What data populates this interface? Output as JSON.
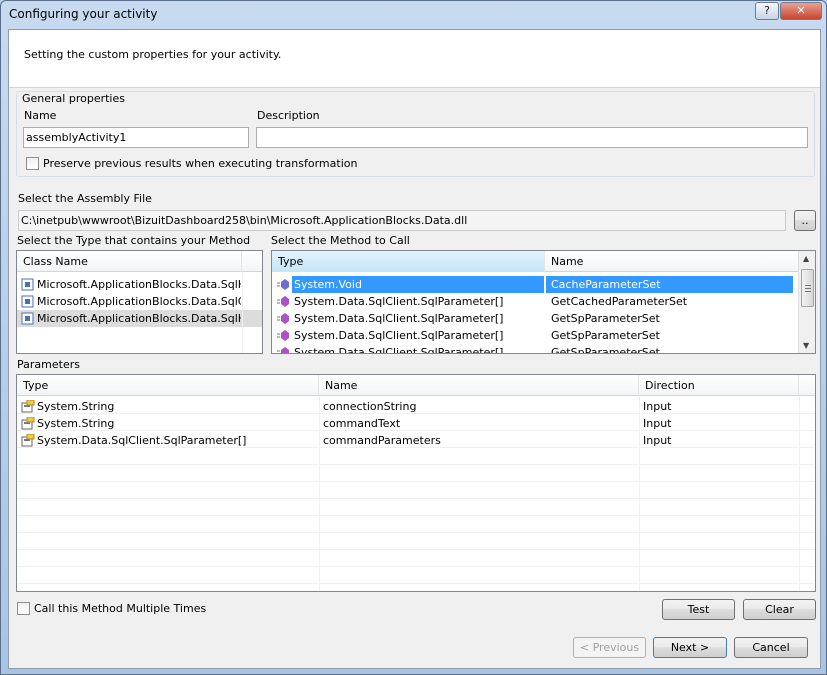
{
  "window": {
    "title": "Configuring your activity",
    "help_label": "?",
    "close_label": "✕"
  },
  "header": {
    "description": "Setting the custom properties for your activity."
  },
  "general": {
    "group_label": "General properties",
    "name_label": "Name",
    "name_value": "assemblyActivity1",
    "description_label": "Description",
    "description_value": "",
    "preserve_label": "Preserve previous results when executing transformation",
    "preserve_checked": false
  },
  "assembly": {
    "label": "Select the Assembly File",
    "path": "C:\\inetpub\\wwwroot\\BizuitDashboard258\\bin\\Microsoft.ApplicationBlocks.Data.dll",
    "browse_label": ".."
  },
  "types": {
    "label": "Select the Type that contains your Method",
    "column": "Class Name",
    "rows": [
      {
        "name": "Microsoft.ApplicationBlocks.Data.SqlHe...",
        "selected": false
      },
      {
        "name": "Microsoft.ApplicationBlocks.Data.SqlCo...",
        "selected": false
      },
      {
        "name": "Microsoft.ApplicationBlocks.Data.SqlHe...",
        "selected": true
      }
    ]
  },
  "methods": {
    "label": "Select the Method to Call",
    "columns": [
      "Type",
      "Name"
    ],
    "rows": [
      {
        "type": "System.Void",
        "name": "CacheParameterSet",
        "selected": true
      },
      {
        "type": "System.Data.SqlClient.SqlParameter[]",
        "name": "GetCachedParameterSet",
        "selected": false
      },
      {
        "type": "System.Data.SqlClient.SqlParameter[]",
        "name": "GetSpParameterSet",
        "selected": false
      },
      {
        "type": "System.Data.SqlClient.SqlParameter[]",
        "name": "GetSpParameterSet",
        "selected": false
      },
      {
        "type": "System.Data.SqlClient.SqlParameter[]",
        "name": "GetSpParameterSet",
        "selected": false
      }
    ]
  },
  "parameters": {
    "label": "Parameters",
    "columns": [
      "Type",
      "Name",
      "Direction"
    ],
    "rows": [
      {
        "type": "System.String",
        "name": "connectionString",
        "direction": "Input"
      },
      {
        "type": "System.String",
        "name": "commandText",
        "direction": "Input"
      },
      {
        "type": "System.Data.SqlClient.SqlParameter[]",
        "name": "commandParameters",
        "direction": "Input"
      }
    ]
  },
  "footer": {
    "multiple_label": "Call this Method Multiple Times",
    "test_label": "Test",
    "clear_label": "Clear",
    "previous_label": "< Previous",
    "next_label": "Next >",
    "cancel_label": "Cancel"
  },
  "colors": {
    "selection": "#3399ff",
    "method_icon": "#b050c8",
    "class_icon": "#4a6fb5"
  }
}
